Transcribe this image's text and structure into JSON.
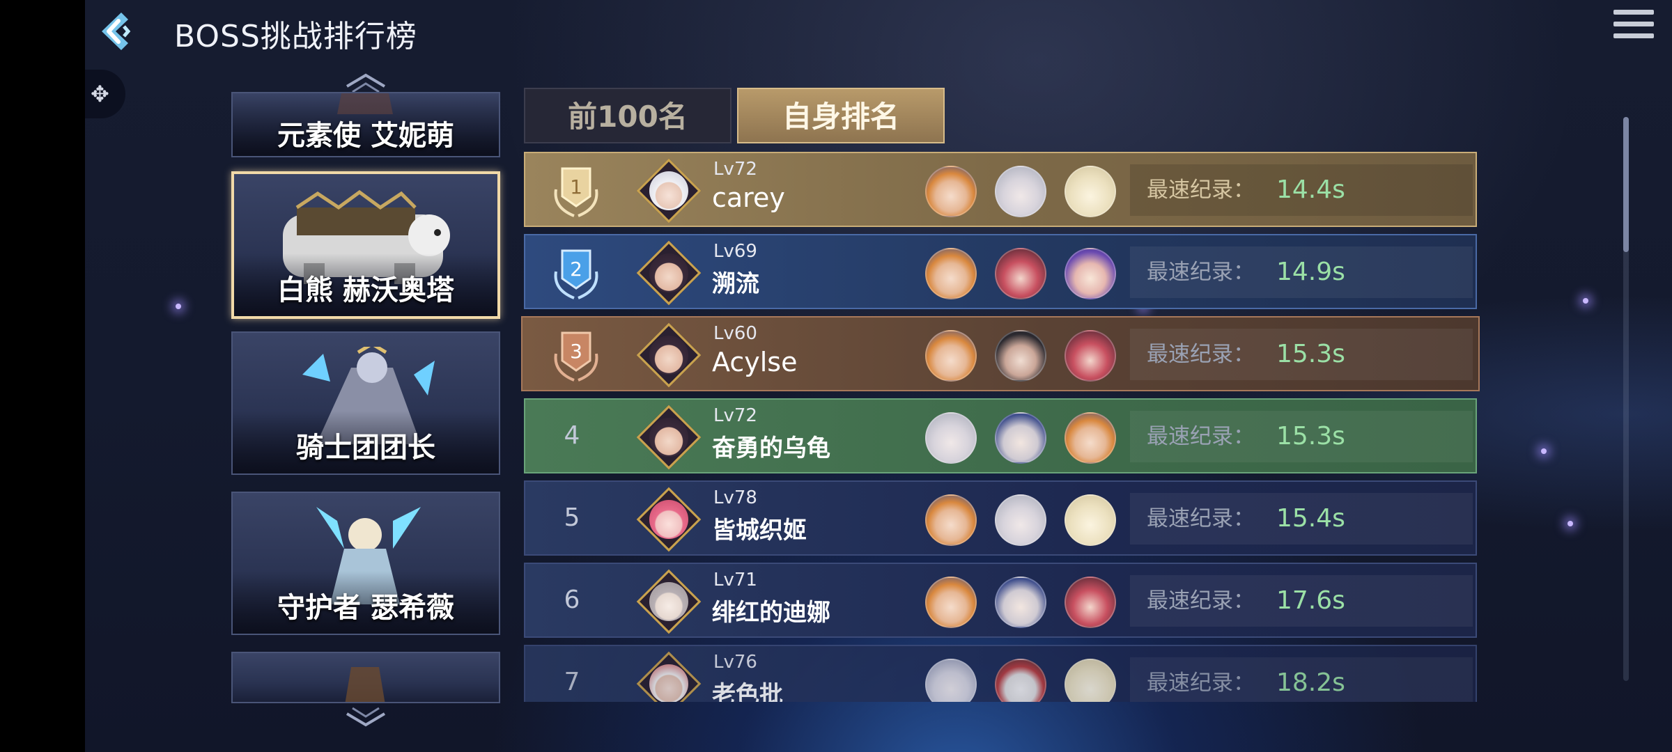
{
  "header": {
    "title": "BOSS挑战排行榜",
    "back_icon": "back-chevron-icon",
    "menu_icon": "hamburger-menu-icon",
    "side_icon": "puzzle-icon"
  },
  "boss_list": {
    "up_icon": "chevron-up-icon",
    "down_icon": "chevron-down-icon",
    "items": [
      {
        "name": "元素使 艾妮萌",
        "selected": false
      },
      {
        "name": "白熊 赫沃奥塔",
        "selected": true
      },
      {
        "name": "骑士团团长",
        "selected": false
      },
      {
        "name": "守护者 瑟希薇",
        "selected": false
      },
      {
        "name": "",
        "selected": false
      }
    ]
  },
  "tabs": [
    {
      "label": "前100名",
      "active": false
    },
    {
      "label": "自身排名",
      "active": true
    }
  ],
  "record_label": "最速纪录：",
  "rankings": [
    {
      "rank": "1",
      "level": "Lv72",
      "name": "carey",
      "time": "14.4s",
      "style": "gold"
    },
    {
      "rank": "2",
      "level": "Lv69",
      "name": "溯流",
      "time": "14.9s",
      "style": "silver"
    },
    {
      "rank": "3",
      "level": "Lv60",
      "name": "Acylse",
      "time": "15.3s",
      "style": "bronze"
    },
    {
      "rank": "4",
      "level": "Lv72",
      "name": "奋勇的乌龟",
      "time": "15.3s",
      "style": "self"
    },
    {
      "rank": "5",
      "level": "Lv78",
      "name": "皆城织姬",
      "time": "15.4s",
      "style": "normal"
    },
    {
      "rank": "6",
      "level": "Lv71",
      "name": "绯红的迪娜",
      "time": "17.6s",
      "style": "normal"
    },
    {
      "rank": "7",
      "level": "Lv76",
      "name": "老色批",
      "time": "18.2s",
      "style": "normal"
    }
  ],
  "colors": {
    "gold": "#9a845c",
    "silver": "#2e4a7e",
    "bronze": "#7a5a42",
    "self_highlight": "#4a7a56",
    "record_value": "#9be0a6",
    "selected_border": "#f1d9a8"
  }
}
